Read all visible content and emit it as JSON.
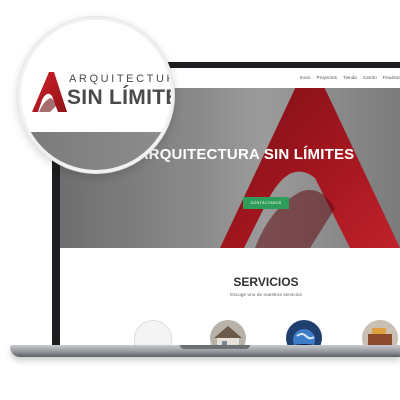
{
  "zoom_logo": {
    "line1": "ARQUITECTURA",
    "line2": "SIN LÍMITES"
  },
  "nav": {
    "items": [
      {
        "label": "Inicio"
      },
      {
        "label": "Proyectos"
      },
      {
        "label": "Tienda"
      },
      {
        "label": "Carrito"
      },
      {
        "label": "Finalizar"
      }
    ]
  },
  "hero": {
    "title": "ARQUITECTURA SIN LÍMITES",
    "cta_label": "CONTÁCTANOS"
  },
  "services": {
    "title": "SERVICIOS",
    "subtitle": "Escoge uno de nuestros servicios"
  },
  "colors": {
    "brand_red": "#9b1720",
    "cta_green": "#2e9d59",
    "text_dark": "#4a4a4a"
  }
}
